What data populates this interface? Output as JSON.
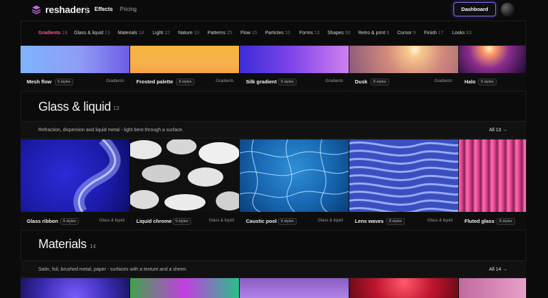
{
  "brand": {
    "name": "reshaders",
    "accent": "#ff4fa3"
  },
  "nav": {
    "effects": "Effects",
    "pricing": "Pricing",
    "dashboard": "Dashboard"
  },
  "categories": [
    {
      "label": "Gradients",
      "count": "18"
    },
    {
      "label": "Glass & liquid",
      "count": "13"
    },
    {
      "label": "Materials",
      "count": "14"
    },
    {
      "label": "Light",
      "count": "22"
    },
    {
      "label": "Nature",
      "count": "10"
    },
    {
      "label": "Patterns",
      "count": "25"
    },
    {
      "label": "Flow",
      "count": "15"
    },
    {
      "label": "Particles",
      "count": "10"
    },
    {
      "label": "Forms",
      "count": "13"
    },
    {
      "label": "Shapes",
      "count": "60"
    },
    {
      "label": "Retro & print",
      "count": "8"
    },
    {
      "label": "Cursor",
      "count": "9"
    },
    {
      "label": "Finish",
      "count": "17"
    },
    {
      "label": "Looks",
      "count": "83"
    }
  ],
  "gradients_row": [
    {
      "name": "Mesh flow",
      "styles": "9 styles",
      "tag": "Gradients"
    },
    {
      "name": "Frosted palette",
      "styles": "8 styles",
      "tag": "Gradients"
    },
    {
      "name": "Silk gradient",
      "styles": "8 styles",
      "tag": "Gradients"
    },
    {
      "name": "Dusk",
      "styles": "8 styles",
      "tag": "Gradients"
    },
    {
      "name": "Halo",
      "styles": "8 styles",
      "tag": ""
    }
  ],
  "glass": {
    "title": "Glass & liquid",
    "count": "13",
    "description": "Refraction, dispersion and liquid metal - light bent through a surface.",
    "all": "All 13 →",
    "cards": [
      {
        "name": "Glass ribbon",
        "styles": "9 styles",
        "tag": "Glass & liquid"
      },
      {
        "name": "Liquid chrome",
        "styles": "9 styles",
        "tag": "Glass & liquid"
      },
      {
        "name": "Caustic pool",
        "styles": "9 styles",
        "tag": "Glass & liquid"
      },
      {
        "name": "Lens waves",
        "styles": "8 styles",
        "tag": "Glass & liquid"
      },
      {
        "name": "Fluted glass",
        "styles": "8 styles",
        "tag": ""
      }
    ]
  },
  "materials": {
    "title": "Materials",
    "count": "14",
    "description": "Satin, foil, brushed metal, paper - surfaces with a texture and a sheen.",
    "all": "All 14 →"
  }
}
